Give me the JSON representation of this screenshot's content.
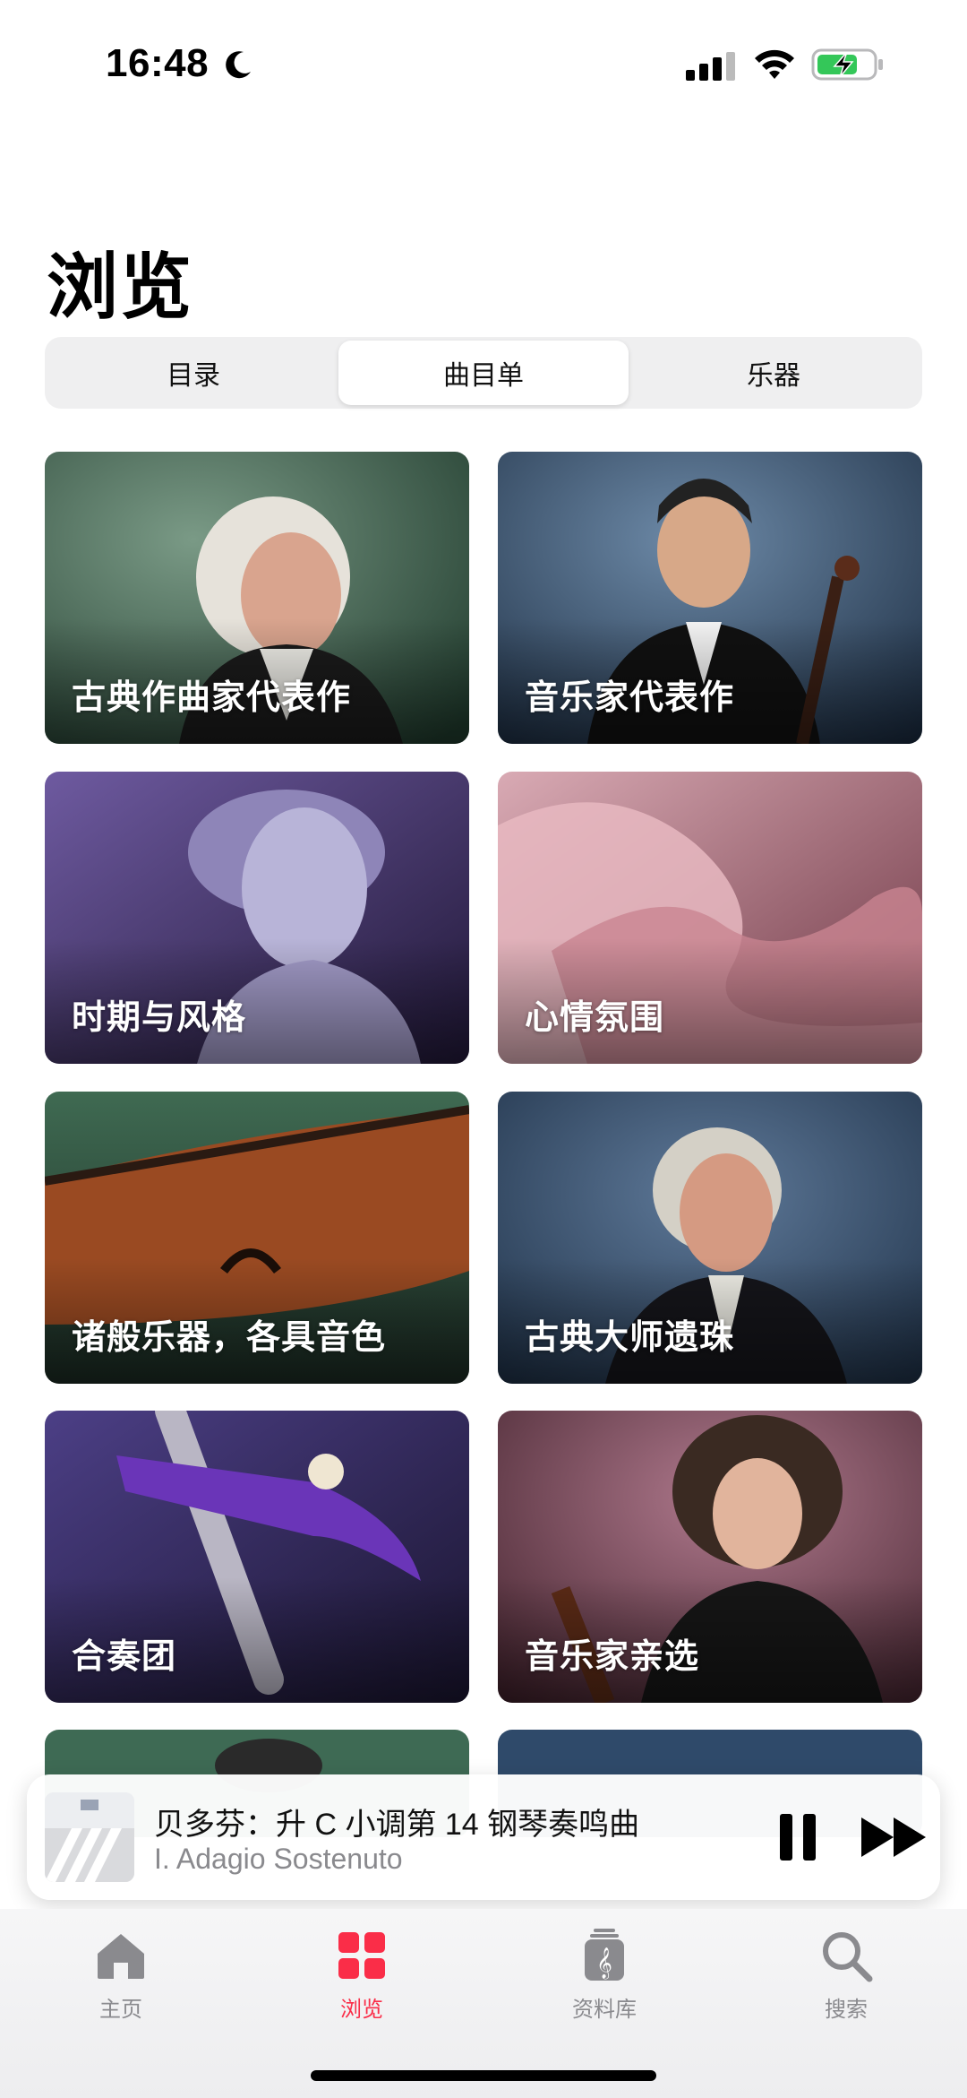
{
  "status_bar": {
    "time": "16:48"
  },
  "header": {
    "title": "浏览"
  },
  "segments": [
    {
      "label": "目录",
      "active": false
    },
    {
      "label": "曲目单",
      "active": true
    },
    {
      "label": "乐器",
      "active": false
    }
  ],
  "cards": [
    {
      "label": "古典作曲家代表作"
    },
    {
      "label": "音乐家代表作"
    },
    {
      "label": "时期与风格"
    },
    {
      "label": "心情氛围"
    },
    {
      "label": "诸般乐器，各具音色"
    },
    {
      "label": "古典大师遗珠"
    },
    {
      "label": "合奏团"
    },
    {
      "label": "音乐家亲选"
    }
  ],
  "mini_player": {
    "title": "贝多芬：升 C 小调第 14 钢琴奏鸣曲",
    "subtitle": "I. Adagio Sostenuto"
  },
  "tab_bar": [
    {
      "label": "主页",
      "icon": "house-icon",
      "active": false
    },
    {
      "label": "浏览",
      "icon": "grid-icon",
      "active": true
    },
    {
      "label": "资料库",
      "icon": "library-icon",
      "active": false
    },
    {
      "label": "搜索",
      "icon": "search-icon",
      "active": false
    }
  ],
  "colors": {
    "accent": "#fa2d48",
    "inactive": "#8a8a8e",
    "segmented_bg": "#efeff0"
  }
}
